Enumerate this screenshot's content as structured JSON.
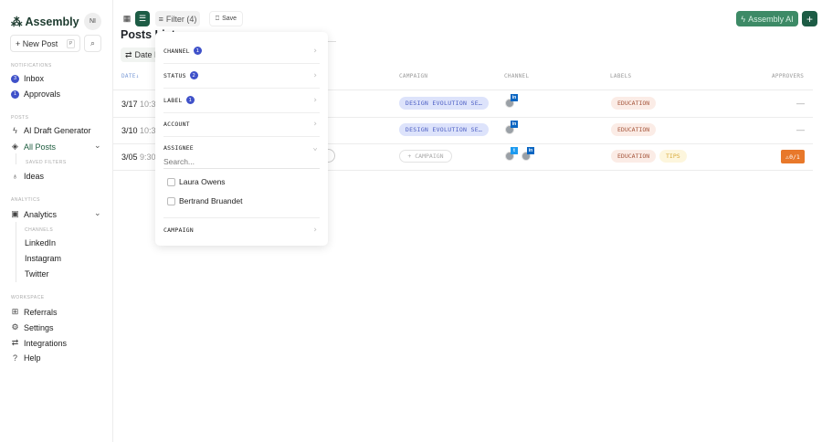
{
  "sidebar": {
    "brand": "Assembly",
    "avatar": "NI",
    "new_post": "+ New Post",
    "new_post_shortcut": "P",
    "sections": {
      "notifications": "NOTIFICATIONS",
      "posts": "POSTS",
      "saved_filters": "SAVED FILTERS",
      "analytics": "ANALYTICS",
      "channels": "CHANNELS",
      "workspace": "WORKSPACE"
    },
    "inbox": {
      "label": "Inbox",
      "count": "3"
    },
    "approvals": {
      "label": "Approvals",
      "count": "1"
    },
    "ai_draft": "AI Draft Generator",
    "all_posts": "All Posts",
    "ideas": "Ideas",
    "analytics": "Analytics",
    "channels": [
      "LinkedIn",
      "Instagram",
      "Twitter"
    ],
    "workspace": [
      "Referrals",
      "Settings",
      "Integrations",
      "Help"
    ]
  },
  "toolbar": {
    "filter": "Filter (4)",
    "save": "Save",
    "assembly_ai": "Assembly AI",
    "add": "+"
  },
  "page": {
    "title": "Posts List",
    "date_button": "Date Range"
  },
  "table": {
    "headers": {
      "date": "DATE",
      "campaign": "CAMPAIGN",
      "channel": "CHANNEL",
      "labels": "LABELS",
      "approvers": "APPROVERS"
    },
    "rows": [
      {
        "date": "3/17",
        "time": "10:30",
        "status": "",
        "campaign": "DESIGN EVOLUTION SE…",
        "channels": [
          "in"
        ],
        "labels": [
          "EDUCATION"
        ],
        "approvers": "—"
      },
      {
        "date": "3/10",
        "time": "10:30",
        "status": "",
        "campaign": "DESIGN EVOLUTION SE…",
        "channels": [
          "in"
        ],
        "labels": [
          "EDUCATION"
        ],
        "approvers": "—"
      },
      {
        "date": "3/05",
        "time": "9:30",
        "status": "ACTIVE",
        "campaign": "+ CAMPAIGN",
        "channels": [
          "t",
          "in"
        ],
        "labels": [
          "EDUCATION",
          "TIPS"
        ],
        "approvers": "0/1"
      }
    ]
  },
  "filter_menu": {
    "channel": {
      "label": "CHANNEL",
      "count": "1"
    },
    "status": {
      "label": "STATUS",
      "count": "2"
    },
    "label": {
      "label": "LABEL",
      "count": "1"
    },
    "account": {
      "label": "ACCOUNT"
    },
    "assignee": {
      "label": "ASSIGNEE",
      "search_placeholder": "Search...",
      "options": [
        "Laura Owens",
        "Bertrand Bruandet"
      ]
    },
    "campaign": {
      "label": "CAMPAIGN"
    }
  }
}
